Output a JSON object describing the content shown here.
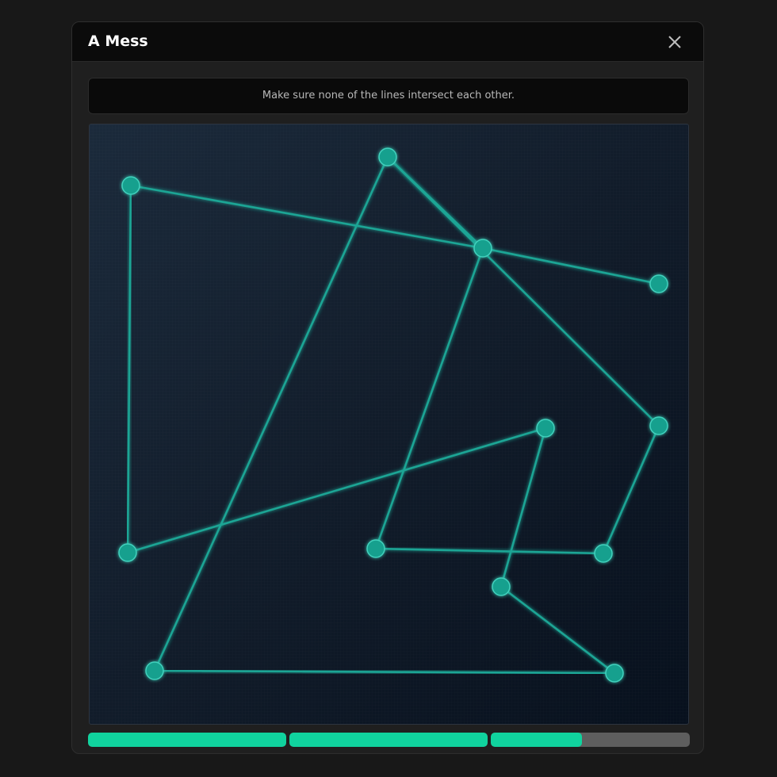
{
  "window": {
    "title": "A Mess"
  },
  "instructions": "Make sure none of the lines intersect each other.",
  "puzzle": {
    "nodes": [
      {
        "id": "n1"
      },
      {
        "id": "n2"
      },
      {
        "id": "n3"
      },
      {
        "id": "n4"
      },
      {
        "id": "n5"
      },
      {
        "id": "n6"
      },
      {
        "id": "n7"
      },
      {
        "id": "n8"
      },
      {
        "id": "n9"
      },
      {
        "id": "n10"
      },
      {
        "id": "n11"
      },
      {
        "id": "n12"
      }
    ],
    "edges": [
      [
        "n1",
        "n3"
      ],
      [
        "n1",
        "n9"
      ],
      [
        "n3",
        "n4"
      ],
      [
        "n2",
        "n3"
      ],
      [
        "n2",
        "n5"
      ],
      [
        "n2",
        "n10"
      ],
      [
        "n5",
        "n7"
      ],
      [
        "n3",
        "n8"
      ],
      [
        "n7",
        "n8"
      ],
      [
        "n6",
        "n9"
      ],
      [
        "n6",
        "n11"
      ],
      [
        "n10",
        "n12"
      ],
      [
        "n11",
        "n12"
      ]
    ],
    "colors": {
      "line": "#1ea595",
      "node": "#14a08e",
      "node_border": "#42d1bd"
    }
  },
  "progress": {
    "segments": [
      {
        "fill": 1.0
      },
      {
        "fill": 1.0
      },
      {
        "fill": 0.46
      }
    ],
    "colors": {
      "fill": "#10d39e",
      "track": "#5e5e5e"
    }
  }
}
